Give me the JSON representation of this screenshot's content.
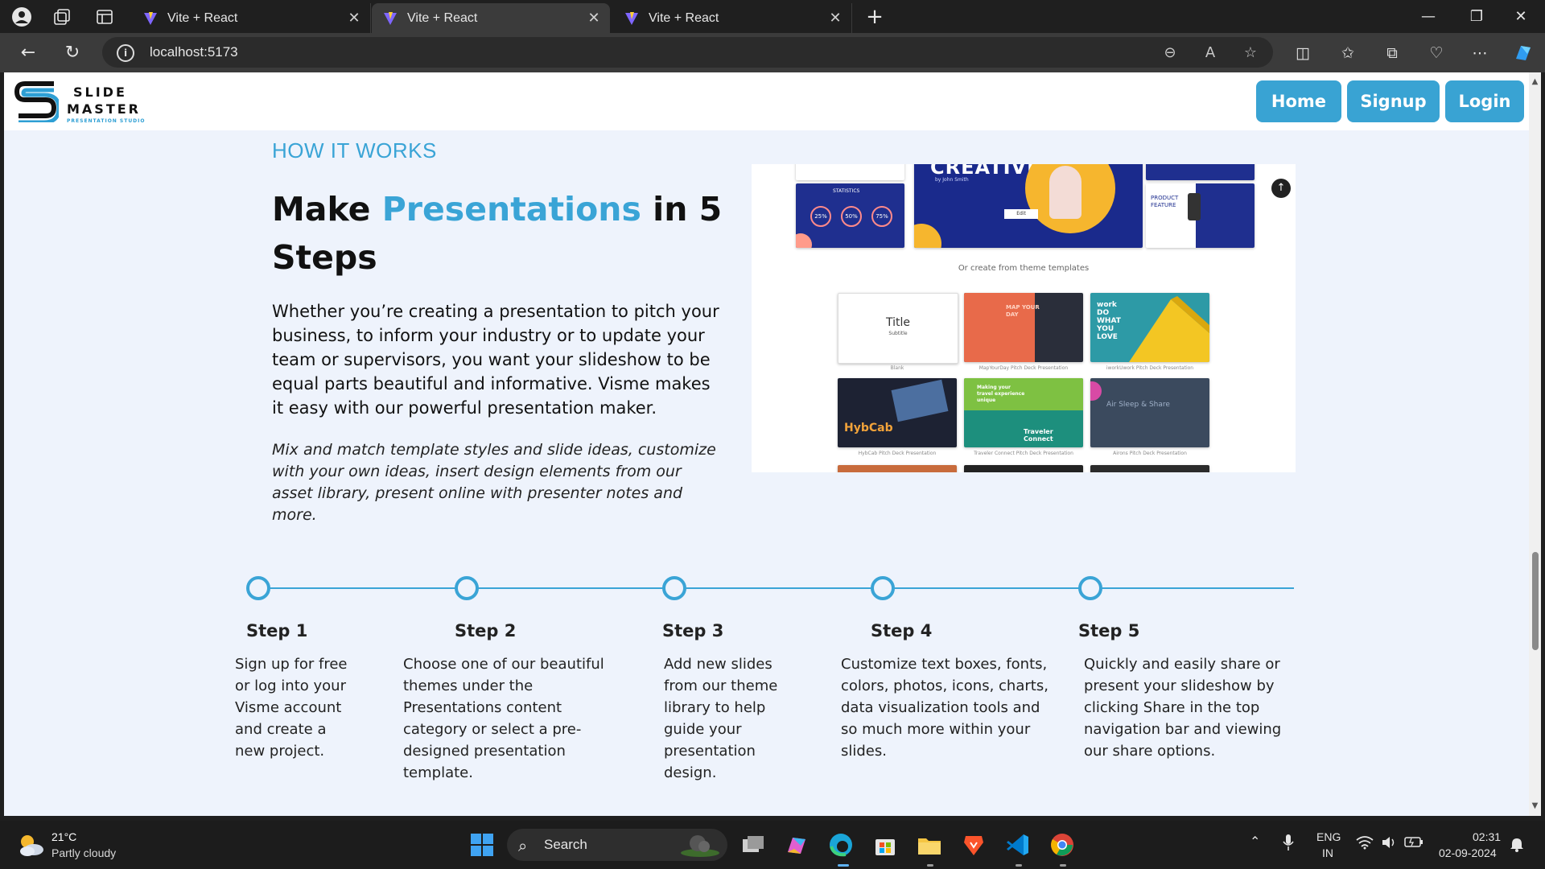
{
  "browser": {
    "tabs": [
      {
        "title": "Vite + React",
        "active": false
      },
      {
        "title": "Vite + React",
        "active": true
      },
      {
        "title": "Vite + React",
        "active": false
      }
    ],
    "url": "localhost:5173"
  },
  "site": {
    "logo": {
      "word1": "SLIDE",
      "word2": "MASTER",
      "tagline": "PRESENTATION STUDIO"
    },
    "nav": {
      "home": "Home",
      "signup": "Signup",
      "login": "Login"
    },
    "accent_color": "#39a3d3"
  },
  "hero": {
    "kicker": "HOW IT WORKS",
    "title_before": "Make ",
    "title_highlight": "Presentations",
    "title_after": " in 5 Steps",
    "lead": "Whether you’re creating a presentation to pitch your business, to inform your industry or to update your team or supervisors, you want your slideshow to be equal parts beautiful and informative. Visme makes it easy with our powerful presentation maker.",
    "note": "Mix and match template styles and slide ideas, customize with your own ideas, insert design elements from our asset library, present online with presenter notes and more."
  },
  "preview": {
    "section_label": "Or create from theme templates",
    "top_cards": {
      "stats": "STATISTICS",
      "stats_values": [
        "25%",
        "50%",
        "75%"
      ],
      "creative": "CREATIVE",
      "creative_by": "by John Smith",
      "creative_btn": "Edit",
      "product": "PRODUCT FEATURE"
    },
    "templates": [
      {
        "thumb": "Title",
        "thumb_sub": "Subtitle",
        "caption": "Blank"
      },
      {
        "thumb": "MAP YOUR DAY",
        "caption": "MapYourDay Pitch Deck Presentation"
      },
      {
        "thumb": "work DO WHAT YOU LOVE",
        "caption": "iworkUwork Pitch Deck Presentation"
      },
      {
        "thumb": "HybCab",
        "caption": "HybCab Pitch Deck Presentation"
      },
      {
        "thumb": "Making your travel experience unique",
        "thumb_brand": "Traveler Connect",
        "caption": "Traveler Connect Pitch Deck Presentation"
      },
      {
        "thumb": "Air Sleep & Share",
        "caption": "Airons Pitch Deck Presentation"
      }
    ]
  },
  "steps": [
    {
      "title": "Step 1",
      "desc": "Sign up for free or log into your Visme account and create a new project."
    },
    {
      "title": "Step 2",
      "desc": "Choose one of our beautiful themes under the Presentations content category or select a pre-designed presentation template."
    },
    {
      "title": "Step 3",
      "desc": "Add new slides from our theme library to help guide your presentation design."
    },
    {
      "title": "Step 4",
      "desc": "Customize text boxes, fonts, colors, photos, icons, charts, data visualization tools and so much more within your slides."
    },
    {
      "title": "Step 5",
      "desc": "Quickly and easily share or present your slideshow by clicking Share in the top navigation bar and viewing our share options."
    }
  ],
  "taskbar": {
    "temperature": "21°C",
    "condition": "Partly cloudy",
    "search": "Search",
    "lang1": "ENG",
    "lang2": "IN",
    "time": "02:31",
    "date": "02-09-2024"
  }
}
